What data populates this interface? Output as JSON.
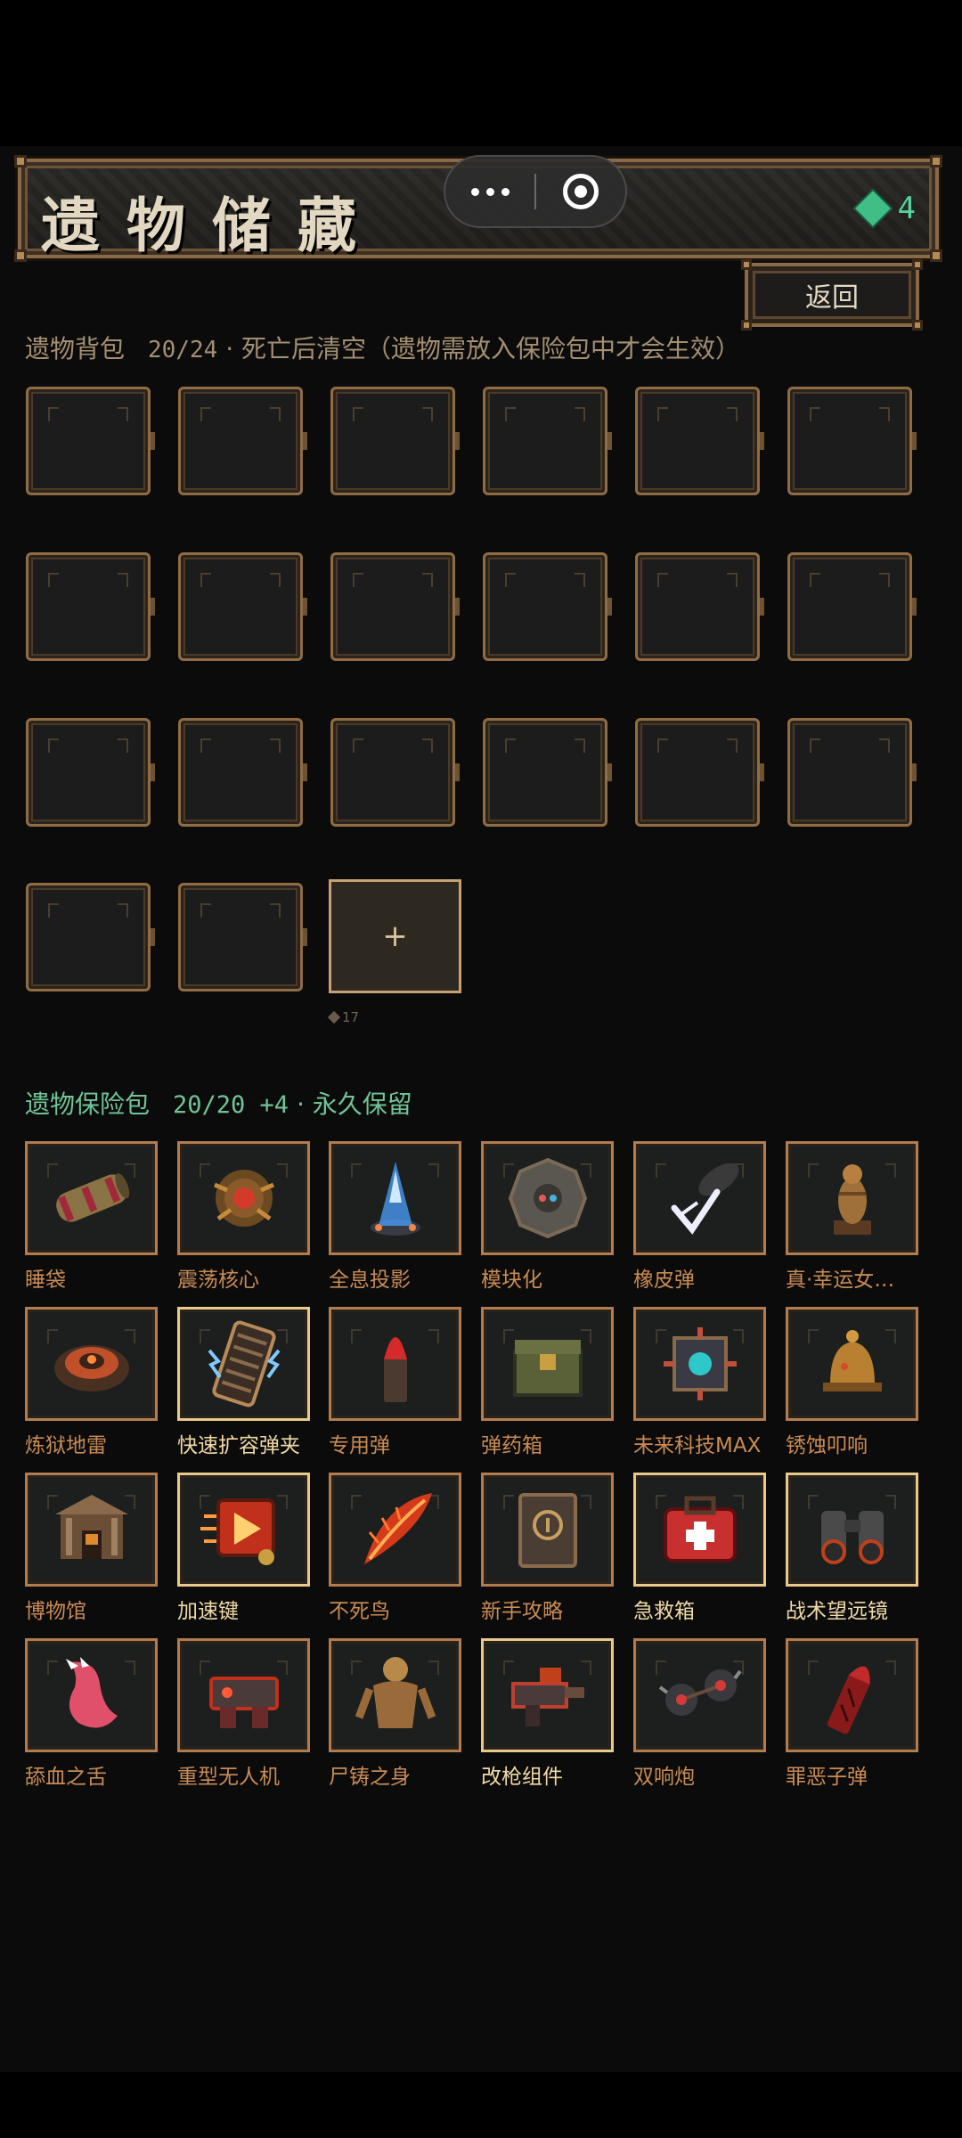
{
  "header": {
    "title": "遗物储藏",
    "currency_value": "4",
    "back_label": "返回",
    "colors": {
      "currency": "#55d39a",
      "frame": "#8a6a46"
    }
  },
  "bag": {
    "title": "遗物背包",
    "count": "20/24",
    "note": "· 死亡后清空（遗物需放入保险包中才会生效）",
    "slot_count": 20,
    "add_label": "+",
    "add_cost": "17"
  },
  "vault": {
    "title": "遗物保险包",
    "count": "20/20 +4",
    "note": "· 永久保留",
    "items": [
      {
        "label": "睡袋",
        "icon": "sleeping-bag-icon"
      },
      {
        "label": "震荡核心",
        "icon": "shock-core-icon"
      },
      {
        "label": "全息投影",
        "icon": "hologram-icon"
      },
      {
        "label": "模块化",
        "icon": "modular-icon"
      },
      {
        "label": "橡皮弹",
        "icon": "rubber-bullet-icon"
      },
      {
        "label": "真·幸运女…",
        "icon": "lucky-statue-icon"
      },
      {
        "label": "炼狱地雷",
        "icon": "landmine-icon"
      },
      {
        "label": "快速扩容弹夹",
        "icon": "extended-magazine-icon",
        "highlight": true
      },
      {
        "label": "专用弹",
        "icon": "special-bullet-icon"
      },
      {
        "label": "弹药箱",
        "icon": "ammo-box-icon"
      },
      {
        "label": "未来科技MAX",
        "icon": "future-tech-icon"
      },
      {
        "label": "锈蚀叩响",
        "icon": "rusted-bell-icon"
      },
      {
        "label": "博物馆",
        "icon": "museum-icon"
      },
      {
        "label": "加速键",
        "icon": "speed-key-icon",
        "highlight": true
      },
      {
        "label": "不死鸟",
        "icon": "phoenix-feather-icon"
      },
      {
        "label": "新手攻略",
        "icon": "guide-book-icon"
      },
      {
        "label": "急救箱",
        "icon": "first-aid-icon",
        "highlight": true
      },
      {
        "label": "战术望远镜",
        "icon": "binoculars-icon",
        "highlight": true
      },
      {
        "label": "舔血之舌",
        "icon": "tongue-icon"
      },
      {
        "label": "重型无人机",
        "icon": "heavy-drone-icon"
      },
      {
        "label": "尸铸之身",
        "icon": "corpse-body-icon"
      },
      {
        "label": "改枪组件",
        "icon": "gun-mod-icon",
        "highlight": true
      },
      {
        "label": "双响炮",
        "icon": "double-bomb-icon"
      },
      {
        "label": "罪恶子弹",
        "icon": "sin-bullet-icon"
      }
    ]
  }
}
